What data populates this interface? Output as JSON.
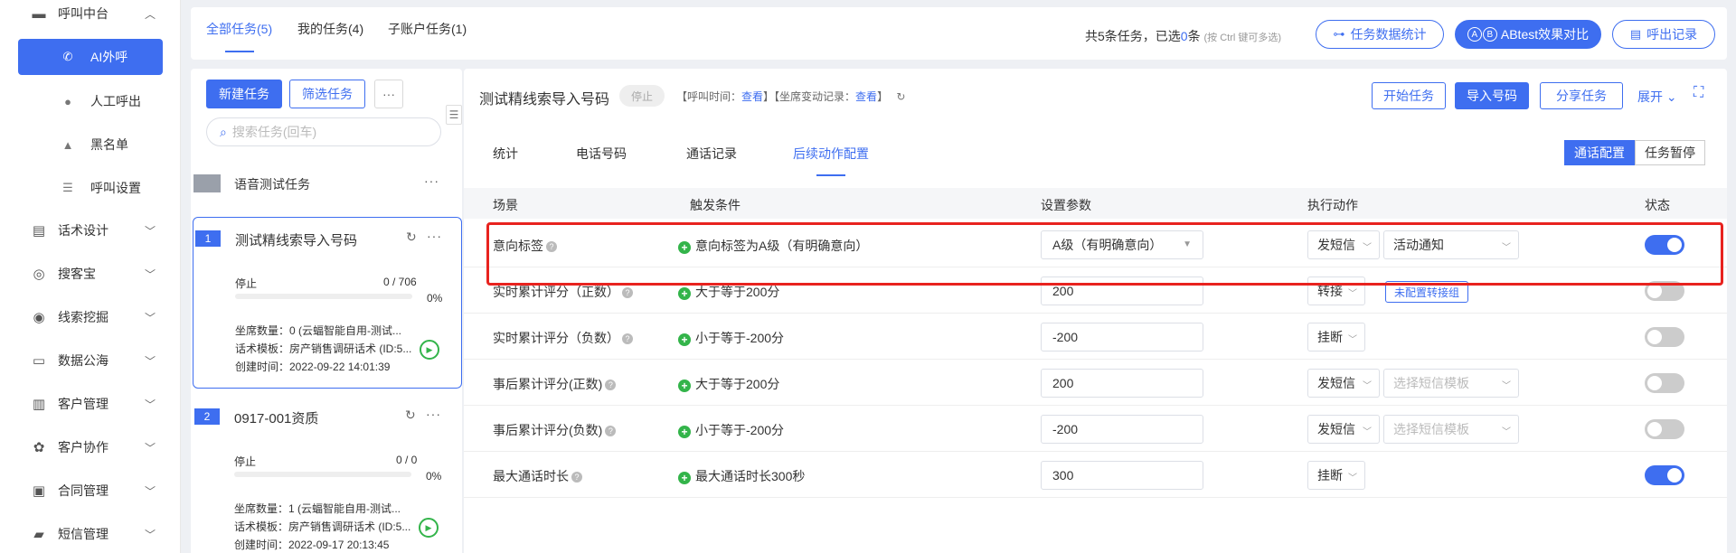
{
  "nav": {
    "items": [
      {
        "label": "呼叫中台",
        "icon": "monitor-icon",
        "chev": "^"
      },
      {
        "label": "AI外呼",
        "icon": "phone-icon",
        "active": true
      },
      {
        "label": "人工呼出",
        "icon": "user-icon"
      },
      {
        "label": "黑名单",
        "icon": "warning-icon"
      },
      {
        "label": "呼叫设置",
        "icon": "sliders-icon"
      },
      {
        "label": "话术设计",
        "icon": "script-icon",
        "chev": "v"
      },
      {
        "label": "搜客宝",
        "icon": "search-customer-icon",
        "chev": "v"
      },
      {
        "label": "线索挖掘",
        "icon": "target-icon",
        "chev": "v"
      },
      {
        "label": "数据公海",
        "icon": "chart-icon",
        "chev": "v"
      },
      {
        "label": "客户管理",
        "icon": "customer-icon",
        "chev": "v"
      },
      {
        "label": "客户协作",
        "icon": "collab-icon",
        "chev": "v"
      },
      {
        "label": "合同管理",
        "icon": "contract-icon",
        "chev": "v"
      },
      {
        "label": "短信管理",
        "icon": "sms-icon",
        "chev": "v"
      }
    ]
  },
  "topbar": {
    "tabs": [
      "全部任务(5)",
      "我的任务(4)",
      "子账户任务(1)"
    ],
    "info_prefix": "共5条任务，已选",
    "info_count": "0",
    "info_suffix": "条",
    "info_hint": "(按 Ctrl 键可多选)",
    "btn_stats": "任务数据统计",
    "btn_ab": "ABtest效果对比",
    "btn_ab_a": "A",
    "btn_ab_b": "B",
    "btn_records": "呼出记录"
  },
  "tasklist": {
    "new_task": "新建任务",
    "filter_task": "筛选任务",
    "more": "···",
    "search_placeholder": "搜索任务(回车)",
    "group_name": "语音测试任务",
    "cards": [
      {
        "index": "1",
        "name": "测试精线索导入号码",
        "status": "停止",
        "progress": "0 / 706",
        "progress_fraction": 0,
        "percent": "0%",
        "seats": "坐席数量：0 (云蝠智能自用-测试...",
        "template": "话术模板：房产销售调研话术 (ID:5...",
        "created": "创建时间：2022-09-22 14:01:39"
      },
      {
        "index": "2",
        "name": "0917-001资质",
        "status": "停止",
        "progress": "0 / 0",
        "progress_fraction": 0,
        "percent": "0%",
        "seats": "坐席数量：1 (云蝠智能自用-测试...",
        "template": "话术模板：房产销售调研话术 (ID:5...",
        "created": "创建时间：2022-09-17 20:13:45"
      }
    ]
  },
  "detail": {
    "title": "测试精线索导入号码",
    "status": "停止",
    "call_time_label": "【呼叫时间：",
    "call_time_link": "查看",
    "seat_change_label": "】【坐席变动记录：",
    "seat_change_link": "查看",
    "bracket_close": "】",
    "btn_start": "开始任务",
    "btn_import": "导入号码",
    "btn_share": "分享任务",
    "expand": "展开",
    "sub_tabs": [
      "统计",
      "电话号码",
      "通话记录",
      "后续动作配置"
    ],
    "seg_call_config": "通话配置",
    "seg_pause": "任务暂停",
    "columns": [
      "场景",
      "触发条件",
      "设置参数",
      "执行动作",
      "状态"
    ],
    "rows": [
      {
        "scene": "意向标签",
        "trigger": "意向标签为A级（有明确意向）",
        "param": "A级（有明确意向）",
        "param_dropdown": true,
        "action": "发短信",
        "action2": "活动通知",
        "enabled": true
      },
      {
        "scene": "实时累计评分（正数）",
        "trigger": "大于等于200分",
        "param": "200",
        "action": "转接",
        "tag": "未配置转接组",
        "enabled": false
      },
      {
        "scene": "实时累计评分（负数）",
        "trigger": "小于等于-200分",
        "param": "-200",
        "action": "挂断",
        "enabled": false
      },
      {
        "scene": "事后累计评分(正数)",
        "trigger": "大于等于200分",
        "param": "200",
        "action": "发短信",
        "action2_placeholder": "选择短信模板",
        "enabled": false
      },
      {
        "scene": "事后累计评分(负数)",
        "trigger": "小于等于-200分",
        "param": "-200",
        "action": "发短信",
        "action2_placeholder": "选择短信模板",
        "enabled": false
      },
      {
        "scene": "最大通话时长",
        "trigger": "最大通话时长300秒",
        "param": "300",
        "action": "挂断",
        "enabled": true
      }
    ]
  },
  "colors": {
    "accent": "#3e6ef0",
    "success": "#33b44a",
    "highlight": "#e8231f"
  }
}
